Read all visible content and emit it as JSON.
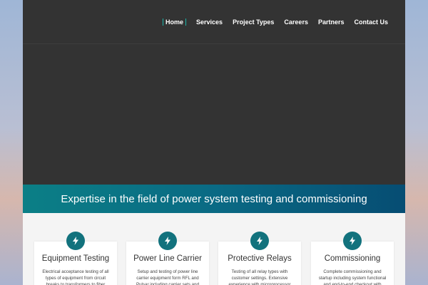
{
  "nav": {
    "items": [
      {
        "label": "Home",
        "active": true
      },
      {
        "label": "Services",
        "active": false
      },
      {
        "label": "Project Types",
        "active": false
      },
      {
        "label": "Careers",
        "active": false
      },
      {
        "label": "Partners",
        "active": false
      },
      {
        "label": "Contact Us",
        "active": false
      }
    ]
  },
  "banner": {
    "text": "Expertise in the field of power system testing and commissioning"
  },
  "services": [
    {
      "icon": "lightning-bolt-icon",
      "title": "Equipment Testing",
      "description": "Electrical acceptance testing of all types of equipment from circuit breaks to transformers to fiber distribution"
    },
    {
      "icon": "lightning-bolt-icon",
      "title": "Power Line Carrier",
      "description": "Setup and testing of power line carrier equipment form RFL and Pulsar including carrier sets and tuners"
    },
    {
      "icon": "lightning-bolt-icon",
      "title": "Protective Relays",
      "description": "Testing of all relay types with customer settings. Extensive experience with microprocessor based relays and schemes"
    },
    {
      "icon": "lightning-bolt-icon",
      "title": "Commissioning",
      "description": "Complete commissioning and startup including system functional and end-to-end checkout with SCADA"
    }
  ],
  "colors": {
    "header_bg": "#333333",
    "accent": "#12727d",
    "nav_active_border": "#1bb5a8",
    "banner_start": "#0b7f86",
    "banner_end": "#064d73"
  }
}
